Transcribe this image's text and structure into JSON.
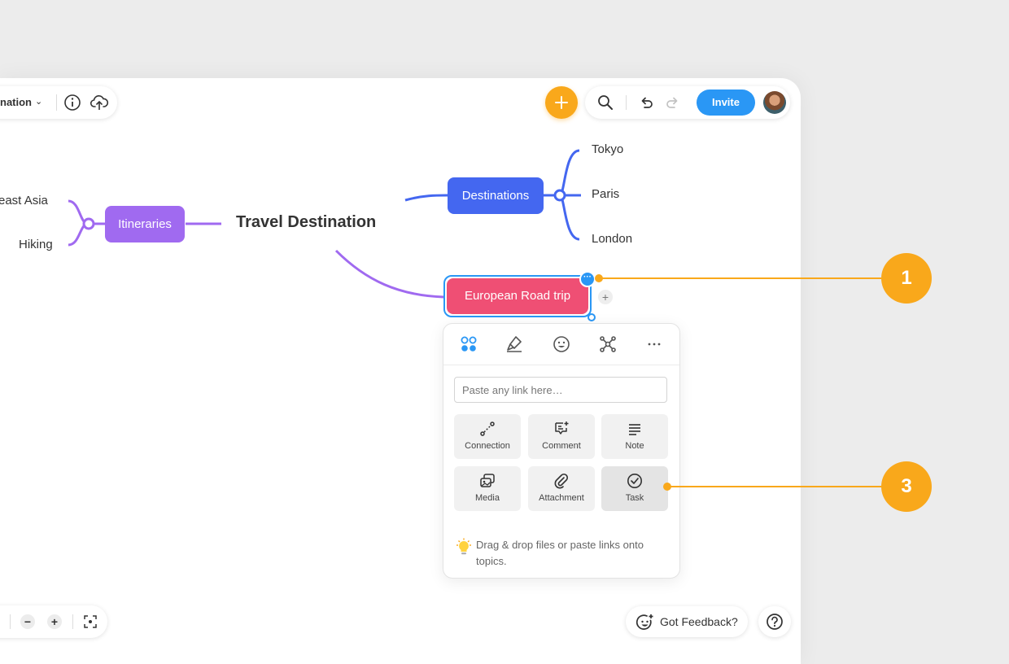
{
  "document": {
    "title": "nation"
  },
  "toolbar": {
    "invite_label": "Invite"
  },
  "mindmap": {
    "central": "Travel Destination",
    "destinations": {
      "label": "Destinations",
      "color": "#4467f0",
      "children": [
        "Tokyo",
        "Paris",
        "London"
      ]
    },
    "itineraries": {
      "label": "Itineraries",
      "color": "#a06af0",
      "children": [
        "east Asia",
        "Hiking"
      ]
    },
    "road_trip": {
      "label": "European Road trip",
      "color": "#ef4f74"
    }
  },
  "panel": {
    "link_placeholder": "Paste any link here…",
    "tiles": [
      "Connection",
      "Comment",
      "Note",
      "Media",
      "Attachment",
      "Task"
    ],
    "hint": "Drag & drop files or paste links onto topics."
  },
  "callouts": [
    "1",
    "3"
  ],
  "footer": {
    "feedback_label": "Got Feedback?"
  },
  "colors": {
    "accent": "#f9a81b",
    "primary": "#2a97f5"
  },
  "icons": [
    "info-icon",
    "cloud-upload-icon",
    "search-icon",
    "undo-icon",
    "redo-icon",
    "plus-icon",
    "topic-icon",
    "brush-icon",
    "emoji-icon",
    "structure-icon",
    "more-icon",
    "bulb-icon",
    "zoom-out-icon",
    "zoom-in-icon",
    "fit-screen-icon",
    "feedback-icon",
    "help-icon"
  ]
}
